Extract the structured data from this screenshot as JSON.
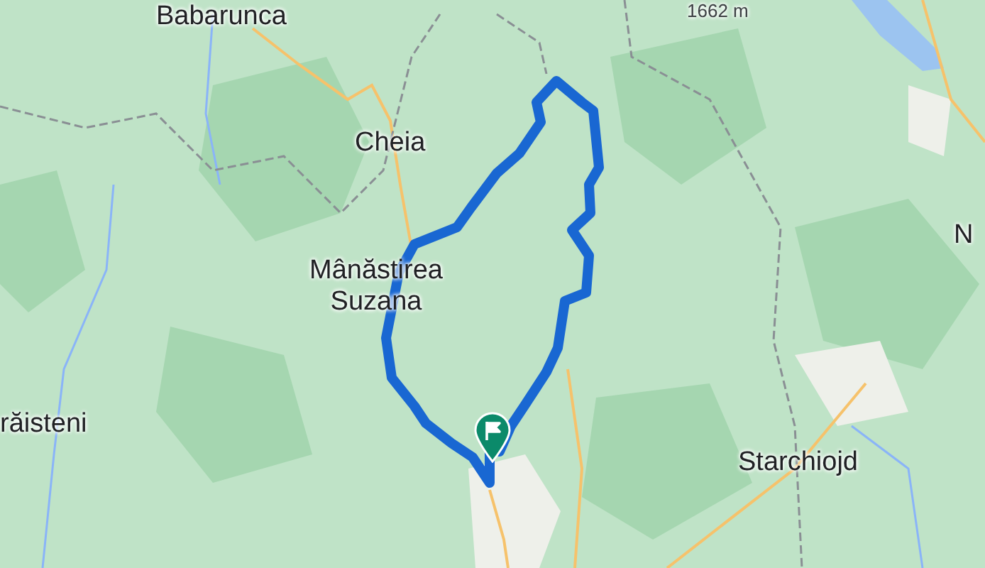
{
  "map": {
    "labels": [
      {
        "text": "Babarunca",
        "kind": "place"
      },
      {
        "text": "1662 m",
        "kind": "peak"
      },
      {
        "text": "Cheia",
        "kind": "place"
      },
      {
        "text": "Mânăstirea Suzana",
        "kind": "place"
      },
      {
        "text": "răisteni",
        "kind": "place"
      },
      {
        "text": "Starchiojd",
        "kind": "place"
      },
      {
        "text": "N",
        "kind": "place"
      }
    ],
    "marker": {
      "kind": "start"
    }
  }
}
